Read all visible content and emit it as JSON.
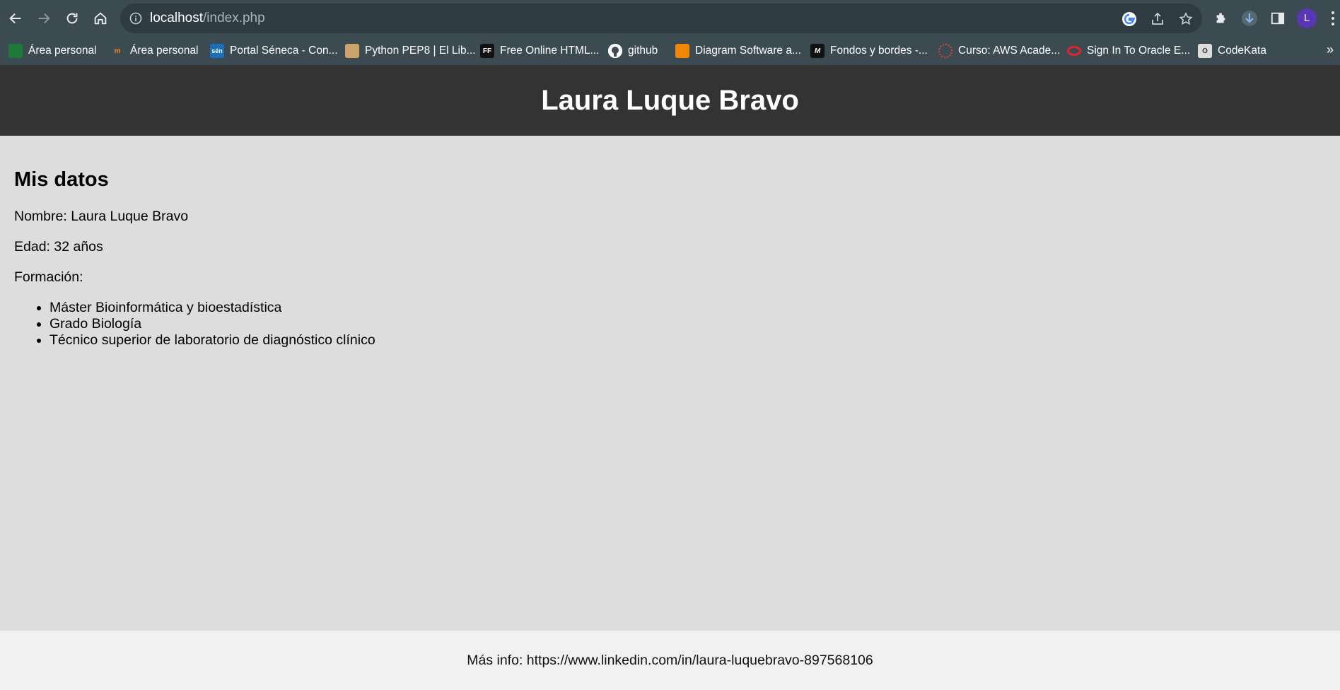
{
  "browser": {
    "url_host": "localhost",
    "url_path": "/index.php",
    "profile_initial": "L",
    "bookmarks": [
      {
        "label": "Área personal",
        "icon": "A"
      },
      {
        "label": "Área personal",
        "icon": "m"
      },
      {
        "label": "Portal Séneca - Con...",
        "icon": "sén"
      },
      {
        "label": "Python PEP8 | El Lib...",
        "icon": "py"
      },
      {
        "label": "Free Online HTML...",
        "icon": "FF"
      },
      {
        "label": "github",
        "icon": "gh"
      },
      {
        "label": "Diagram Software a...",
        "icon": "dg"
      },
      {
        "label": "Fondos y bordes -...",
        "icon": "M"
      },
      {
        "label": "Curso: AWS Acade...",
        "icon": "aws"
      },
      {
        "label": "Sign In To Oracle E...",
        "icon": "or"
      },
      {
        "label": "CodeKata",
        "icon": "O"
      }
    ],
    "more_bookmarks": "»"
  },
  "page": {
    "title": "Laura Luque Bravo",
    "section_title": "Mis datos",
    "nombre": "Nombre: Laura Luque Bravo",
    "edad": "Edad: 32 años",
    "formacion_label": "Formación:",
    "formacion": [
      "Máster Bioinformática y bioestadística",
      "Grado Biología",
      "Técnico superior de laboratorio de diagnóstico clínico"
    ],
    "footer": "Más info: https://www.linkedin.com/in/laura-luquebravo-897568106"
  },
  "colors": {
    "header_bg": "#333333",
    "page_bg": "#dddddd",
    "footer_bg": "#f1f1f1",
    "chrome_bg": "#3c4a52"
  }
}
